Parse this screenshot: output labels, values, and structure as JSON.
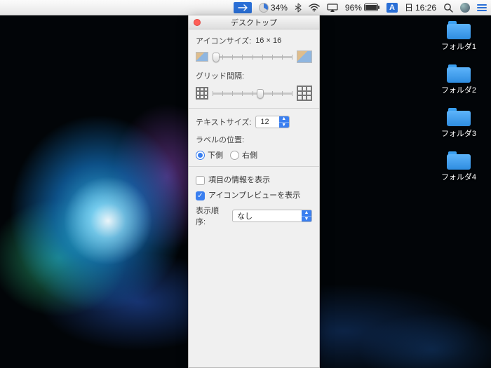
{
  "menubar": {
    "cpu_percent": "34%",
    "battery_percent": "96%",
    "input_source": "A",
    "day": "日",
    "time": "16:26"
  },
  "folders": [
    {
      "label": "フォルダ1"
    },
    {
      "label": "フォルダ2"
    },
    {
      "label": "フォルダ3"
    },
    {
      "label": "フォルダ4"
    }
  ],
  "panel": {
    "title": "デスクトップ",
    "icon_size_label": "アイコンサイズ:",
    "icon_size_value": "16 × 16",
    "grid_spacing_label": "グリッド間隔:",
    "text_size_label": "テキストサイズ:",
    "text_size_value": "12",
    "label_position_label": "ラベルの位置:",
    "label_position_options": {
      "bottom": "下側",
      "right": "右側"
    },
    "show_info_label": "項目の情報を表示",
    "show_preview_label": "アイコンプレビューを表示",
    "sort_label": "表示順序:",
    "sort_value": "なし"
  }
}
